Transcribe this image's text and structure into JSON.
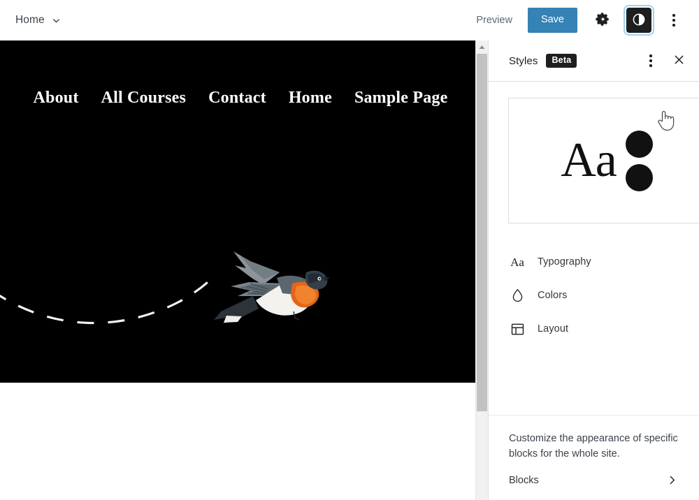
{
  "header": {
    "doc_title": "Home",
    "doc_title_icon": "chevron-down-icon",
    "preview_label": "Preview",
    "save_label": "Save",
    "settings_icon": "gear-icon",
    "styles_toggle_icon": "contrast-icon",
    "more_menu_icon": "dots-vertical-icon",
    "save_color": "#3582b5",
    "focus_ring_color": "#9fd2f2"
  },
  "canvas": {
    "background": "#000000",
    "nav_items": [
      {
        "label": "About"
      },
      {
        "label": "All Courses"
      },
      {
        "label": "Contact"
      },
      {
        "label": "Home"
      },
      {
        "label": "Sample Page"
      }
    ],
    "illustration": {
      "name": "flying-bird-illustration",
      "trail": "dashed-curved-flight-path",
      "bird_colors": {
        "throat": "#e3651a",
        "belly": "#f3f1ec",
        "wing": "#58646d",
        "head": "#2f3b46"
      }
    }
  },
  "scrollbar": {
    "up_arrow_icon": "arrow-up-icon",
    "thumb_color": "#c2c2c2",
    "track_color": "#f1f1f1"
  },
  "sidebar": {
    "title": "Styles",
    "badge": "Beta",
    "more_icon": "dots-vertical-icon",
    "close_icon": "close-icon",
    "preview_card": {
      "sample_text": "Aa",
      "swatches": [
        "#111111",
        "#111111"
      ]
    },
    "menu_items": [
      {
        "label": "Typography",
        "icon": "typography-icon",
        "glyph": "Aa"
      },
      {
        "label": "Colors",
        "icon": "droplet-icon"
      },
      {
        "label": "Layout",
        "icon": "layout-icon"
      }
    ],
    "blocks_description": "Customize the appearance of specific blocks for the whole site.",
    "blocks_label": "Blocks",
    "blocks_chevron_icon": "chevron-right-icon"
  },
  "cursor": {
    "type": "pointing-hand-cursor"
  }
}
